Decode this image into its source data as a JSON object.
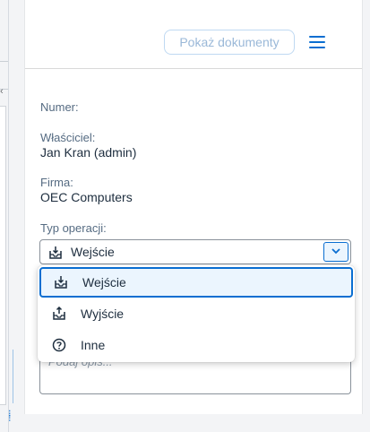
{
  "toolbar": {
    "show_documents_label": "Pokaż dokumenty"
  },
  "form": {
    "number": {
      "label": "Numer:",
      "value": ""
    },
    "owner": {
      "label": "Właściciel:",
      "value": "Jan Kran (admin)"
    },
    "company": {
      "label": "Firma:",
      "value": "OEC Computers"
    },
    "operation_type": {
      "label": "Typ operacji:",
      "selected": "Wejście"
    },
    "description": {
      "placeholder": "Podaj opis..."
    }
  },
  "dropdown": {
    "options": [
      {
        "label": "Wejście",
        "icon": "inbox-in-icon",
        "selected": true
      },
      {
        "label": "Wyjście",
        "icon": "inbox-out-icon",
        "selected": false
      },
      {
        "label": "Inne",
        "icon": "question-circle-icon",
        "selected": false
      }
    ]
  },
  "colors": {
    "accent": "#0a6ed1",
    "selected_bg": "#ebf5fe",
    "text": "#1d2d3e",
    "label": "#556b82"
  }
}
